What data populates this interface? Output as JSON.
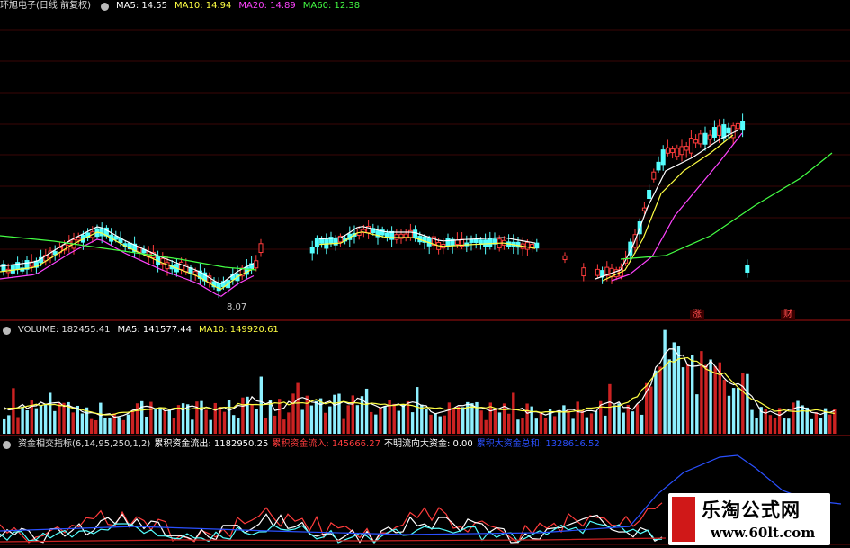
{
  "header": {
    "stock": "环旭电子(日线 前复权)",
    "ma5": "MA5: 14.55",
    "ma10": "MA10: 14.94",
    "ma20": "MA20: 14.89",
    "ma60": "MA60: 12.38"
  },
  "price_panel": {
    "low_label": "8.07",
    "tag_rise": "涨",
    "tag_finance": "财"
  },
  "volume_header": {
    "volume": "VOLUME: 182455.41",
    "ma5": "MA5: 141577.44",
    "ma10": "MA10: 149920.61"
  },
  "indicator_header": {
    "name": "资金相交指标(6,14,95,250,1,2)",
    "out": "累积资金流出: 1182950.25",
    "in": "累积资金流入: 145666.27",
    "unknown": "不明流向大资金: 0.00",
    "big": "累积大资金总和: 1328616.52"
  },
  "watermark": {
    "title": "乐淘公式网",
    "url": "www.60lt.com"
  },
  "colors": {
    "bg": "#000000",
    "up": "#ff3c3c",
    "down": "#54ffff",
    "ma5": "#ffffff",
    "ma10": "#ffff44",
    "ma20": "#ff44ff",
    "ma60": "#44ff44",
    "grid": "#6e0a0a"
  }
}
